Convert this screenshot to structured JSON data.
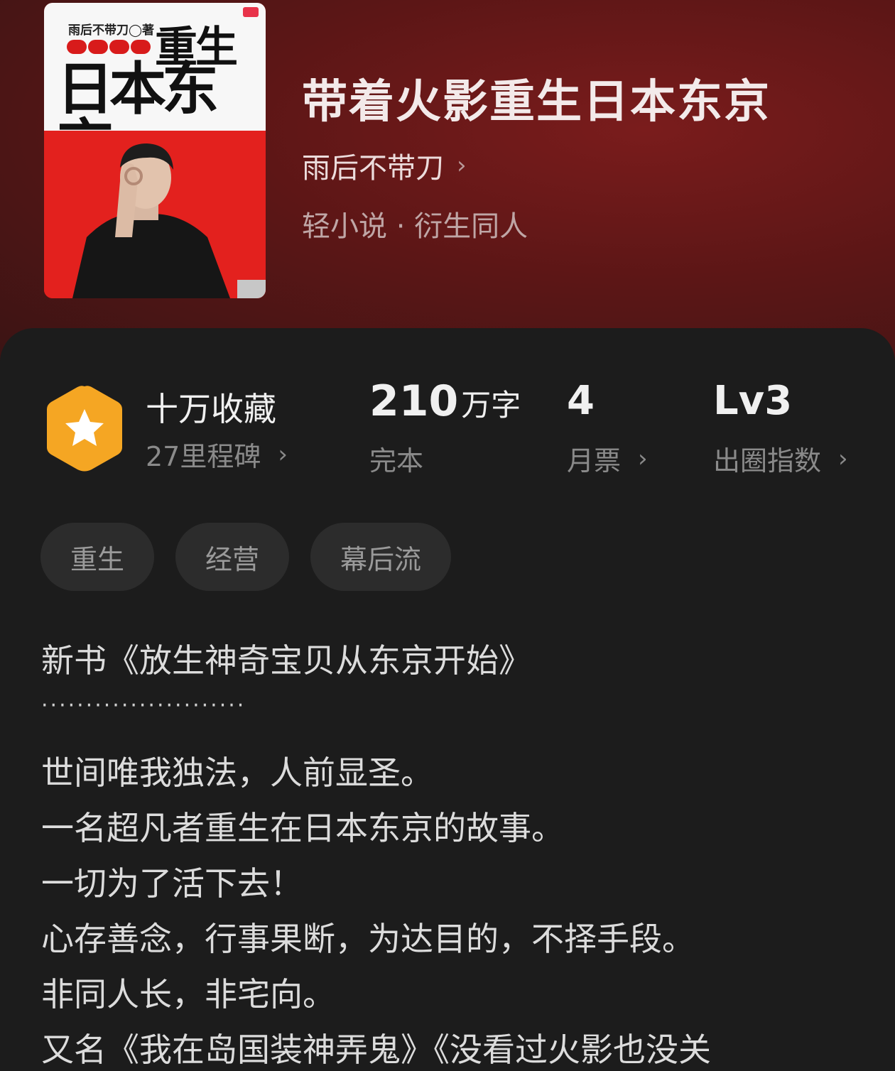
{
  "cover": {
    "author_text": "雨后不带刀◯著",
    "title_line1": "重生",
    "title_line2": "日本东京"
  },
  "book": {
    "title": "带着火影重生日本东京",
    "author": "雨后不带刀",
    "genre": "轻小说 · 衍生同人"
  },
  "stats": {
    "collection": {
      "main": "十万收藏",
      "sub": "27里程碑"
    },
    "words": {
      "number": "210",
      "unit": "万字",
      "status": "完本"
    },
    "monthly_ticket": {
      "value": "4",
      "label": "月票"
    },
    "circle_index": {
      "value": "Lv3",
      "label": "出圈指数"
    }
  },
  "tags": [
    "重生",
    "经营",
    "幕后流"
  ],
  "description": {
    "new_book": "新书《放生神奇宝贝从东京开始》",
    "separator": "·······················",
    "lines": [
      "世间唯我独法，人前显圣。",
      "一名超凡者重生在日本东京的故事。",
      "一切为了活下去！",
      "心存善念，行事果断，为达目的，不择手段。",
      "非同人长，非宅向。",
      "又名《我在岛国装神弄鬼》《没看过火影也没关"
    ]
  },
  "colors": {
    "hero": "#5c1616",
    "panel": "#1c1c1c",
    "hex_badge": "#f5a623"
  }
}
